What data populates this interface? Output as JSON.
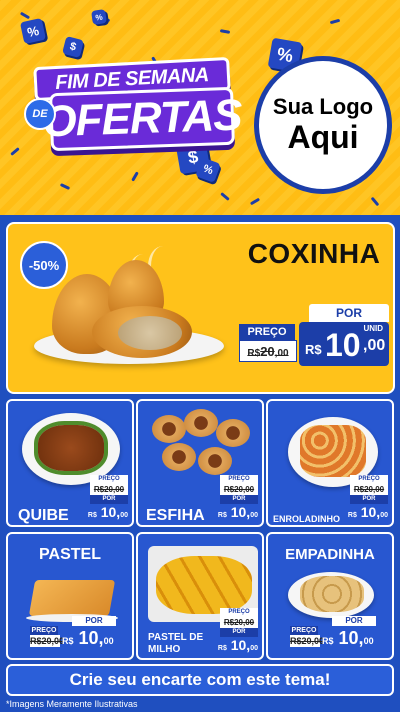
{
  "header": {
    "title_line1": "FIM DE SEMANA",
    "title_de": "DE",
    "title_line2": "OFERTAS",
    "logo_line1": "Sua Logo",
    "logo_line2": "Aqui",
    "badge_symbol_percent": "%",
    "badge_symbol_dollar": "$"
  },
  "featured": {
    "discount": "-50%",
    "name": "COXINHA",
    "por_label": "POR",
    "preco_label": "PREÇO",
    "old_price_currency": "R$",
    "old_price_int": "20",
    "old_price_cents": ",00",
    "unit_label": "UNID",
    "new_price_currency": "R$",
    "new_price_int": "10",
    "new_price_cents": ",00"
  },
  "products": [
    {
      "name": "QUIBE",
      "old_label": "PREÇO",
      "old_price": "R$20,00",
      "por_label": "POR",
      "new_price_currency": "R$",
      "new_price": "10,",
      "new_cents": "00",
      "unit_label": "UNID"
    },
    {
      "name": "ESFIHA",
      "old_label": "PREÇO",
      "old_price": "R$20,00",
      "por_label": "POR",
      "new_price_currency": "R$",
      "new_price": "10,",
      "new_cents": "00",
      "unit_label": "UNID"
    },
    {
      "name": "ENROLADINHO",
      "old_label": "PREÇO",
      "old_price": "R$20,00",
      "por_label": "POR",
      "new_price_currency": "R$",
      "new_price": "10,",
      "new_cents": "00",
      "unit_label": "UNID"
    },
    {
      "name": "PASTEL",
      "old_label": "PREÇO",
      "old_price": "R$20,00",
      "por_label": "POR",
      "new_price_currency": "R$",
      "new_price": "10,",
      "new_cents": "00",
      "unit_label": "UNID"
    },
    {
      "name": "PASTEL DE MILHO",
      "old_label": "PREÇO",
      "old_price": "R$20,00",
      "por_label": "POR",
      "new_price_currency": "R$",
      "new_price": "10,",
      "new_cents": "00",
      "unit_label": "UNID"
    },
    {
      "name": "EMPADINHA",
      "old_label": "PREÇO",
      "old_price": "R$20,00",
      "por_label": "POR",
      "new_price_currency": "R$",
      "new_price": "10,",
      "new_cents": "00",
      "unit_label": "UNID"
    }
  ],
  "cta": {
    "label": "Crie seu encarte com este tema!"
  },
  "footnote": "*Imagens Meramente Ilustrativas",
  "colors": {
    "accent_yellow": "#ffc21a",
    "brand_blue": "#1f4fbf",
    "title_purple": "#6a2bd8"
  }
}
